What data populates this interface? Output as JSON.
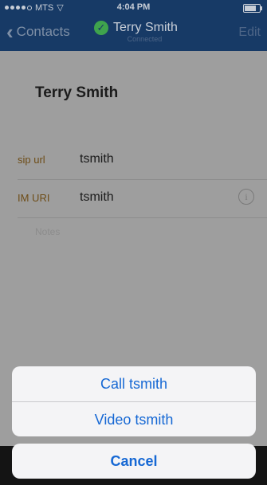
{
  "status_bar": {
    "carrier": "MTS",
    "time": "4:04 PM"
  },
  "nav": {
    "back_label": "Contacts",
    "title": "Terry Smith",
    "subtitle": "Connected",
    "edit_label": "Edit"
  },
  "contact": {
    "name": "Terry Smith",
    "fields": [
      {
        "label": "sip url",
        "value": "tsmith"
      },
      {
        "label": "IM URI",
        "value": "tsmith"
      }
    ],
    "notes_placeholder": "Notes"
  },
  "action_sheet": {
    "call_label": "Call tsmith",
    "video_label": "Video tsmith",
    "cancel_label": "Cancel"
  },
  "colors": {
    "accent": "#1668d4",
    "nav_background": "#173a66",
    "connected_green": "#3fa34d"
  }
}
